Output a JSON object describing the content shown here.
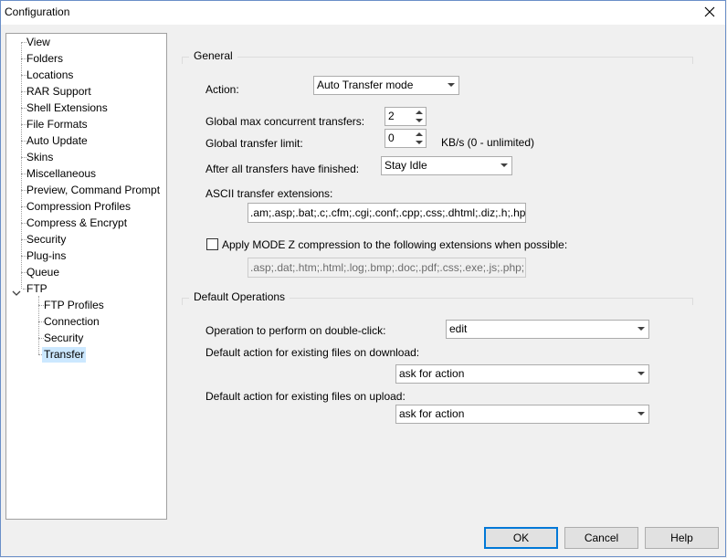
{
  "window": {
    "title": "Configuration",
    "close_icon": "close-icon"
  },
  "tree": {
    "items": [
      {
        "label": "View"
      },
      {
        "label": "Folders"
      },
      {
        "label": "Locations"
      },
      {
        "label": "RAR Support"
      },
      {
        "label": "Shell Extensions"
      },
      {
        "label": "File Formats"
      },
      {
        "label": "Auto Update"
      },
      {
        "label": "Skins"
      },
      {
        "label": "Miscellaneous"
      },
      {
        "label": "Preview, Command Prompt"
      },
      {
        "label": "Compression Profiles"
      },
      {
        "label": "Compress & Encrypt"
      },
      {
        "label": "Security"
      },
      {
        "label": "Plug-ins"
      },
      {
        "label": "Queue"
      },
      {
        "label": "FTP"
      }
    ],
    "ftp_children": [
      {
        "label": "FTP Profiles"
      },
      {
        "label": "Connection"
      },
      {
        "label": "Security"
      },
      {
        "label": "Transfer",
        "selected": true
      }
    ]
  },
  "general": {
    "legend": "General",
    "action_label": "Action:",
    "action_value": "Auto Transfer mode",
    "max_concurrent_label": "Global max concurrent transfers:",
    "max_concurrent_value": "2",
    "transfer_limit_label": "Global transfer limit:",
    "transfer_limit_value": "0",
    "transfer_limit_unit": "KB/s (0 - unlimited)",
    "after_transfers_label": "After all transfers have finished:",
    "after_transfers_value": "Stay Idle",
    "ascii_label": "ASCII transfer extensions:",
    "ascii_value": ".am;.asp;.bat;.c;.cfm;.cgi;.conf;.cpp;.css;.dhtml;.diz;.h;.hpp",
    "modez_label": "Apply MODE Z compression to the following extensions when possible:",
    "modez_checked": false,
    "modez_value": ".asp;.dat;.htm;.html;.log;.bmp;.doc;.pdf;.css;.exe;.js;.php;."
  },
  "default_ops": {
    "legend": "Default Operations",
    "double_click_label": "Operation to perform on double-click:",
    "double_click_value": "edit",
    "download_label": "Default action for existing files on download:",
    "download_value": "ask for action",
    "upload_label": "Default action for existing files on upload:",
    "upload_value": "ask for action"
  },
  "buttons": {
    "ok": "OK",
    "cancel": "Cancel",
    "help": "Help"
  }
}
